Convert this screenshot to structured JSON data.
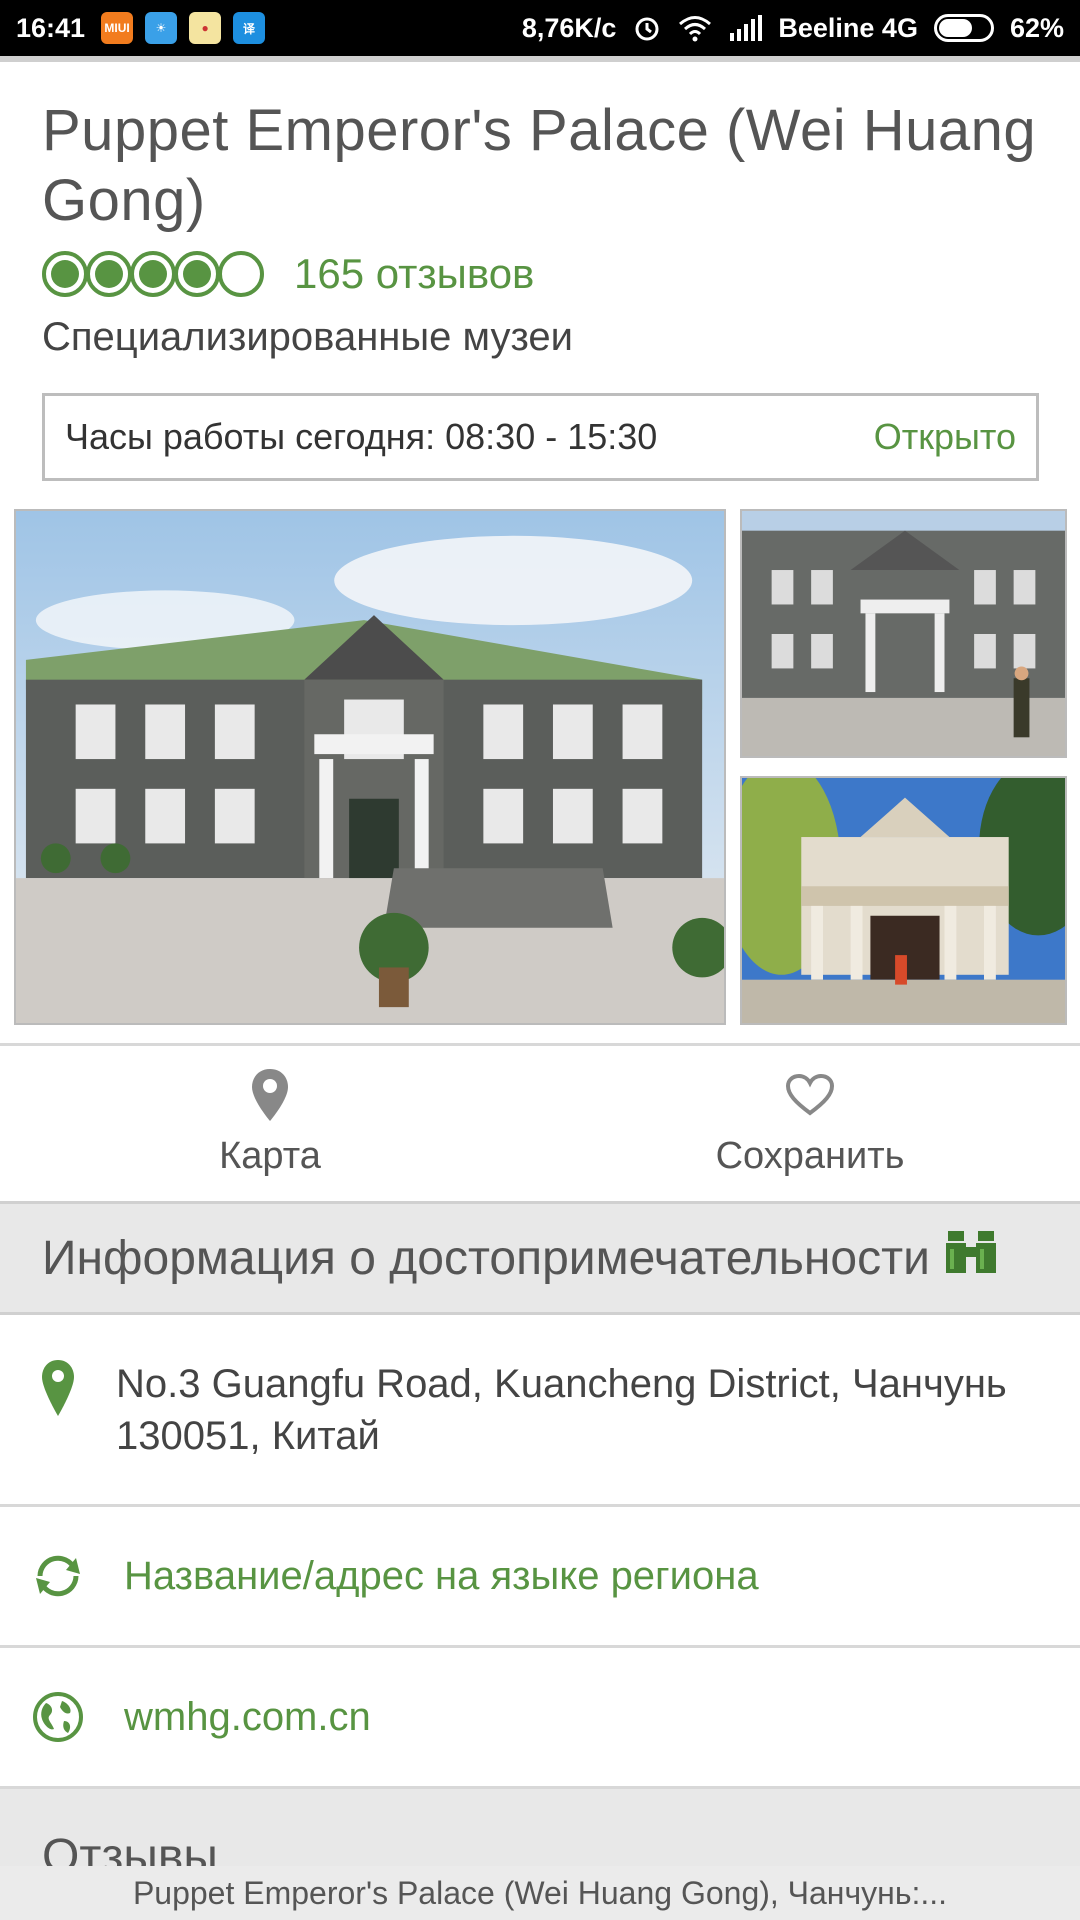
{
  "status_bar": {
    "time": "16:41",
    "net_speed": "8,76K/c",
    "carrier": "Beeline 4G",
    "battery": "62%",
    "battery_level": 0.62
  },
  "attraction": {
    "title": "Puppet Emperor's Palace (Wei Huang Gong)",
    "rating": 4,
    "rating_max": 5,
    "reviews_count": "165 отзывов",
    "category": "Специализированные музеи",
    "hours_label": "Часы работы сегодня: 08:30 - 15:30",
    "open_status": "Открыто"
  },
  "actions": {
    "map_label": "Карта",
    "save_label": "Сохранить"
  },
  "info_section": {
    "title": "Информация о достопримечательности",
    "address_line1": "No.3 Guangfu Road, Kuancheng District, Чанчунь",
    "address_line2": "130051, Китай",
    "local_name_label": "Название/адрес на языке региона",
    "website": "wmhg.com.cn"
  },
  "reviews_section": {
    "title": "Отзывы"
  },
  "bottom_bar": {
    "text": "Puppet Emperor's Palace (Wei Huang Gong), Чанчунь:..."
  },
  "colors": {
    "accent": "#589442",
    "text": "#444444",
    "section_bg": "#e8e8e8"
  },
  "icons": [
    "map-pin-icon",
    "heart-icon",
    "binoculars-icon",
    "location-pin-icon",
    "sync-icon",
    "globe-icon",
    "wifi-icon",
    "signal-icon",
    "alarm-icon"
  ]
}
